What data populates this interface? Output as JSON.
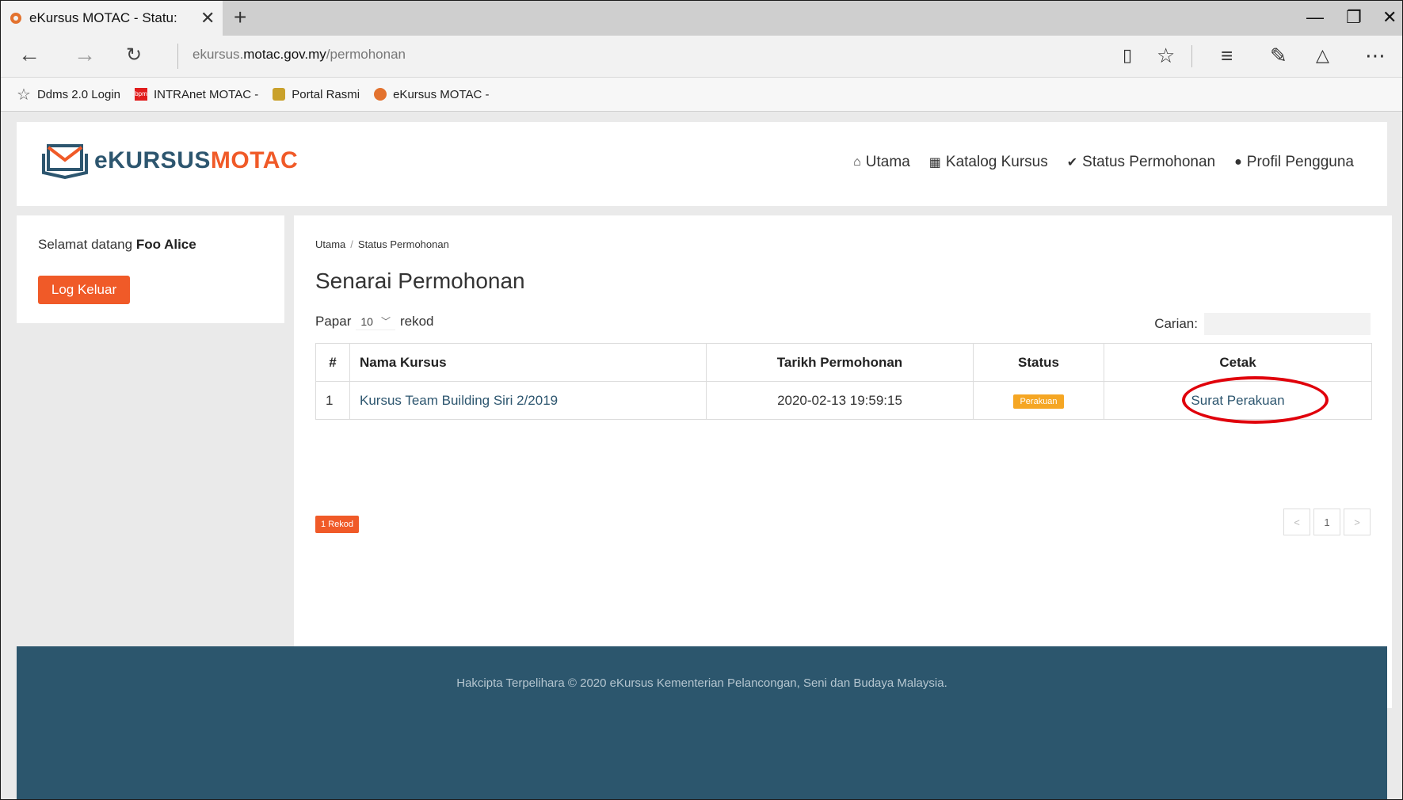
{
  "browser": {
    "tab_title": "eKursus MOTAC - Statu:",
    "tab_close": "✕",
    "new_tab": "+",
    "url_prefix": "ekursus.",
    "url_domain": "motac.gov.my",
    "url_path": "/permohonan",
    "favorites": [
      {
        "label": "Ddms 2.0 Login",
        "icon": "star-icon"
      },
      {
        "label": "INTRAnet MOTAC -",
        "icon": "bpm-icon"
      },
      {
        "label": "Portal Rasmi",
        "icon": "tiger-crest-icon"
      },
      {
        "label": "eKursus MOTAC -",
        "icon": "location-pin-icon"
      }
    ]
  },
  "header": {
    "logo_e": "eKURSUS",
    "logo_m": "MOTAC",
    "nav": [
      {
        "label": "Utama",
        "icon": "home-icon"
      },
      {
        "label": "Katalog Kursus",
        "icon": "calendar-icon"
      },
      {
        "label": "Status Permohonan",
        "icon": "check-circle-icon"
      },
      {
        "label": "Profil Pengguna",
        "icon": "user-icon"
      }
    ]
  },
  "sidebar": {
    "welcome_prefix": "Selamat datang",
    "user_name": "Foo Alice",
    "logout_label": "Log Keluar"
  },
  "main": {
    "breadcrumb": [
      "Utama",
      "Status Permohonan"
    ],
    "title": "Senarai Permohonan",
    "length_prefix": "Papar",
    "length_value": "10",
    "length_suffix": "rekod",
    "search_label": "Carian:",
    "columns": [
      "#",
      "Nama Kursus",
      "Tarikh Permohonan",
      "Status",
      "Cetak"
    ],
    "rows": [
      {
        "num": "1",
        "course": "Kursus Team Building Siri 2/2019",
        "date": "2020-02-13 19:59:15",
        "status": "Perakuan",
        "print": "Surat Perakuan"
      }
    ],
    "record_count": "1 Rekod",
    "page_current": "1"
  },
  "footer": {
    "text": "Hakcipta Terpelihara © 2020 eKursus Kementerian Pelancongan, Seni dan Budaya Malaysia."
  },
  "colors": {
    "accent": "#f05a28",
    "brand_dark": "#2d566f",
    "badge": "#f5a623",
    "annotation": "#e0000b"
  }
}
